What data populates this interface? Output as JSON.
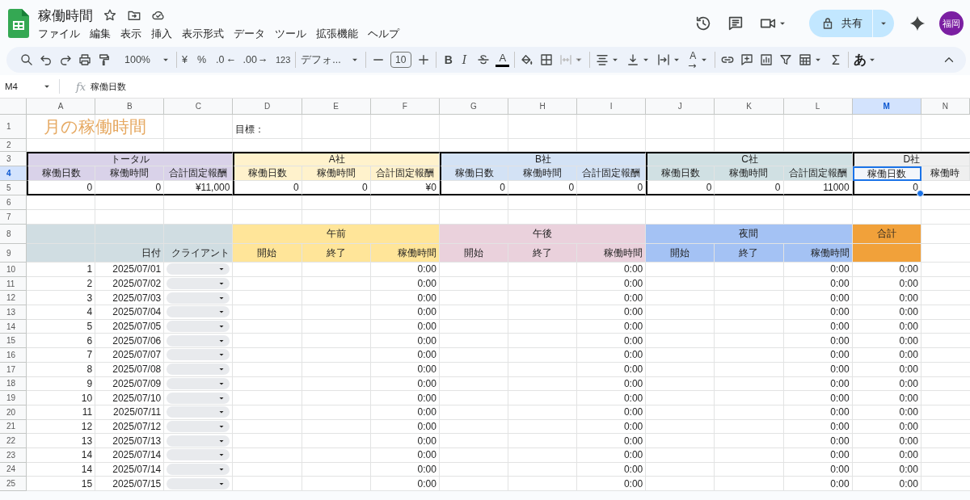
{
  "app": {
    "title": "稼働時間",
    "menu": [
      "ファイル",
      "編集",
      "表示",
      "挿入",
      "表示形式",
      "データ",
      "ツール",
      "拡張機能",
      "ヘルプ"
    ],
    "share": "共有",
    "avatar": "福岡"
  },
  "toolbar": {
    "zoom": "100%",
    "currency": "¥",
    "percent": "%",
    "decrease_decimals": ".0",
    "increase_decimals": ".00",
    "number_format": "123",
    "font": "デフォ...",
    "font_size": "10",
    "bold": "B",
    "italic": "I",
    "text_color": "A",
    "rotation": "A",
    "merge_disabled": true,
    "input_tools": "あ"
  },
  "formula_bar": {
    "cell": "M4",
    "fx_label": "fx",
    "formula": "稼働日数"
  },
  "sheet": {
    "columns": [
      {
        "label": "A",
        "selected": false
      },
      {
        "label": "B",
        "selected": false
      },
      {
        "label": "C",
        "selected": false
      },
      {
        "label": "D",
        "selected": false
      },
      {
        "label": "E",
        "selected": false
      },
      {
        "label": "F",
        "selected": false
      },
      {
        "label": "G",
        "selected": false
      },
      {
        "label": "H",
        "selected": false
      },
      {
        "label": "I",
        "selected": false
      },
      {
        "label": "J",
        "selected": false
      },
      {
        "label": "K",
        "selected": false
      },
      {
        "label": "L",
        "selected": false
      },
      {
        "label": "M",
        "selected": true
      },
      {
        "label": "N",
        "selected": false
      }
    ],
    "row_headers": [
      {
        "label": "1",
        "selected": false
      },
      {
        "label": "2",
        "selected": false
      },
      {
        "label": "3",
        "selected": false
      },
      {
        "label": "4",
        "selected": true
      },
      {
        "label": "5",
        "selected": false
      },
      {
        "label": "6",
        "selected": false
      },
      {
        "label": "7",
        "selected": false
      },
      {
        "label": "8",
        "selected": false
      },
      {
        "label": "9",
        "selected": false
      },
      {
        "label": "10",
        "selected": false
      },
      {
        "label": "11",
        "selected": false
      },
      {
        "label": "12",
        "selected": false
      },
      {
        "label": "13",
        "selected": false
      },
      {
        "label": "14",
        "selected": false
      },
      {
        "label": "15",
        "selected": false
      },
      {
        "label": "16",
        "selected": false
      },
      {
        "label": "17",
        "selected": false
      },
      {
        "label": "18",
        "selected": false
      },
      {
        "label": "19",
        "selected": false
      },
      {
        "label": "20",
        "selected": false
      },
      {
        "label": "21",
        "selected": false
      },
      {
        "label": "22",
        "selected": false
      },
      {
        "label": "23",
        "selected": false
      },
      {
        "label": "24",
        "selected": false
      },
      {
        "label": "25",
        "selected": false
      }
    ],
    "title": "月の稼働時間",
    "target_label": "目標：",
    "summary": [
      {
        "name": "トータル",
        "color": "#d9d2e9",
        "columns": [
          {
            "header": "稼働日数",
            "value": "0",
            "selected": false
          },
          {
            "header": "稼働時間",
            "value": "0",
            "selected": false
          },
          {
            "header": "合計固定報酬",
            "value": "¥11,000",
            "selected": false
          }
        ]
      },
      {
        "name": "A社",
        "color": "#fff2cc",
        "columns": [
          {
            "header": "稼働日数",
            "value": "0",
            "selected": false
          },
          {
            "header": "稼働時間",
            "value": "0",
            "selected": false
          },
          {
            "header": "合計固定報酬",
            "value": "¥0",
            "selected": false
          }
        ]
      },
      {
        "name": "B社",
        "color": "#d3e2f5",
        "columns": [
          {
            "header": "稼働日数",
            "value": "0",
            "selected": false
          },
          {
            "header": "稼働時間",
            "value": "0",
            "selected": false
          },
          {
            "header": "合計固定報酬",
            "value": "0",
            "selected": false
          }
        ]
      },
      {
        "name": "C社",
        "color": "#d0e0e3",
        "columns": [
          {
            "header": "稼働日数",
            "value": "0",
            "selected": false
          },
          {
            "header": "稼働時間",
            "value": "0",
            "selected": false
          },
          {
            "header": "合計固定報酬",
            "value": "11000",
            "selected": false
          }
        ]
      },
      {
        "name": "D社",
        "color": "#efefef",
        "columns": [
          {
            "header": "稼働日数",
            "value": "0",
            "selected": true
          },
          {
            "header": "稼働時",
            "selected": false
          }
        ]
      }
    ],
    "log": {
      "lead": {
        "color": "#d0dde2"
      },
      "date_header": "日付",
      "client_header": "クライアント",
      "periods": [
        {
          "name": "午前",
          "color": "#ffe599",
          "columns": [
            "開始",
            "終了",
            "稼働時間"
          ]
        },
        {
          "name": "午後",
          "color": "#ead1dc",
          "columns": [
            "開始",
            "終了",
            "稼働時間"
          ]
        },
        {
          "name": "夜間",
          "color": "#a4c2f4",
          "columns": [
            "開始",
            "終了",
            "稼働時間"
          ]
        }
      ],
      "total": {
        "name": "合計",
        "color": "#f1a13a"
      },
      "rows": [
        {
          "no": "1",
          "date": "2025/07/01",
          "times": [
            "0:00",
            "0:00",
            "0:00"
          ],
          "total": "0:00"
        },
        {
          "no": "2",
          "date": "2025/07/02",
          "times": [
            "0:00",
            "0:00",
            "0:00"
          ],
          "total": "0:00"
        },
        {
          "no": "3",
          "date": "2025/07/03",
          "times": [
            "0:00",
            "0:00",
            "0:00"
          ],
          "total": "0:00"
        },
        {
          "no": "4",
          "date": "2025/07/04",
          "times": [
            "0:00",
            "0:00",
            "0:00"
          ],
          "total": "0:00"
        },
        {
          "no": "5",
          "date": "2025/07/05",
          "times": [
            "0:00",
            "0:00",
            "0:00"
          ],
          "total": "0:00"
        },
        {
          "no": "6",
          "date": "2025/07/06",
          "times": [
            "0:00",
            "0:00",
            "0:00"
          ],
          "total": "0:00"
        },
        {
          "no": "7",
          "date": "2025/07/07",
          "times": [
            "0:00",
            "0:00",
            "0:00"
          ],
          "total": "0:00"
        },
        {
          "no": "8",
          "date": "2025/07/08",
          "times": [
            "0:00",
            "0:00",
            "0:00"
          ],
          "total": "0:00"
        },
        {
          "no": "9",
          "date": "2025/07/09",
          "times": [
            "0:00",
            "0:00",
            "0:00"
          ],
          "total": "0:00"
        },
        {
          "no": "10",
          "date": "2025/07/10",
          "times": [
            "0:00",
            "0:00",
            "0:00"
          ],
          "total": "0:00"
        },
        {
          "no": "11",
          "date": "2025/07/11",
          "times": [
            "0:00",
            "0:00",
            "0:00"
          ],
          "total": "0:00"
        },
        {
          "no": "12",
          "date": "2025/07/12",
          "times": [
            "0:00",
            "0:00",
            "0:00"
          ],
          "total": "0:00"
        },
        {
          "no": "13",
          "date": "2025/07/13",
          "times": [
            "0:00",
            "0:00",
            "0:00"
          ],
          "total": "0:00"
        },
        {
          "no": "14",
          "date": "2025/07/14",
          "times": [
            "0:00",
            "0:00",
            "0:00"
          ],
          "total": "0:00"
        },
        {
          "no": "14",
          "date": "2025/07/14",
          "times": [
            "0:00",
            "0:00",
            "0:00"
          ],
          "total": "0:00"
        },
        {
          "no": "15",
          "date": "2025/07/15",
          "times": [
            "0:00",
            "0:00",
            "0:00"
          ],
          "total": "0:00"
        }
      ]
    }
  }
}
